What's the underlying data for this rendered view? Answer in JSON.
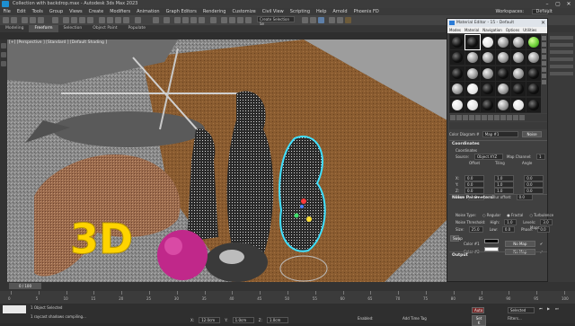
{
  "app": {
    "title": "Collection with backdrop.max - Autodesk 3ds Max 2023",
    "window_buttons": [
      "–",
      "▢",
      "✕"
    ]
  },
  "menu": {
    "items": [
      "File",
      "Edit",
      "Tools",
      "Group",
      "Views",
      "Create",
      "Modifiers",
      "Animation",
      "Graph Editors",
      "Rendering",
      "Customize",
      "Civil View",
      "Scripting",
      "Help",
      "Arnold",
      "Phoenix FD"
    ],
    "workspace_label": "Workspaces:",
    "workspace_value": "Default"
  },
  "toolbar": {
    "selection_set_placeholder": "Create Selection Se"
  },
  "ribbon": {
    "tabs": [
      "Modeling",
      "Freeform",
      "Selection",
      "Object Paint",
      "Populate"
    ],
    "active_tab": "Freeform"
  },
  "viewport": {
    "label": "[+] [Perspective ] [Standard ] [Default Shading ]",
    "overlay_text": "3D"
  },
  "material_editor": {
    "title": "Material Editor - 15 - Default",
    "menu": [
      "Modes",
      "Material",
      "Navigation",
      "Options",
      "Utilities"
    ],
    "slots": [
      "black",
      "black",
      "white",
      "grey",
      "grey",
      "green",
      "black",
      "grey",
      "grey",
      "grey",
      "grey",
      "grey",
      "black",
      "grey",
      "grey",
      "black",
      "grey",
      "black",
      "grey",
      "white",
      "black",
      "grey",
      "black",
      "black",
      "white",
      "white",
      "black",
      "grey",
      "white",
      "black"
    ],
    "name_label": "Color Diagram #",
    "map_type": "Map #1",
    "map_type_button": "Noise",
    "coordinates": {
      "header": "Coordinates",
      "sub": "Coordinates",
      "source_label": "Source:",
      "source_value": "Object XYZ",
      "channel_label": "Map Channel:",
      "channel_value": "1",
      "col_offset": "Offset",
      "col_tiling": "Tiling",
      "col_angle": "Angle",
      "rows": [
        {
          "axis": "X:",
          "offset": "0.0",
          "tiling": "1.0",
          "angle": "0.0"
        },
        {
          "axis": "Y:",
          "offset": "0.0",
          "tiling": "1.0",
          "angle": "0.0"
        },
        {
          "axis": "Z:",
          "offset": "0.0",
          "tiling": "1.0",
          "angle": "0.0"
        }
      ],
      "blur_label": "Blur:",
      "blur_value": "1.0",
      "blur_offset_label": "Blur offset:",
      "blur_offset_value": "0.0"
    },
    "noise": {
      "header": "Noise Parameters",
      "type_label": "Noise Type:",
      "types": [
        "Regular",
        "Fractal",
        "Turbulence"
      ],
      "selected_type": "Fractal",
      "threshold_label": "Noise Threshold:",
      "high_label": "High:",
      "high_value": "1.0",
      "levels_label": "Levels:",
      "levels_value": "3.0",
      "size_label": "Size:",
      "size_value": "25.0",
      "low_label": "Low:",
      "low_value": "0.0",
      "phase_label": "Phase:",
      "phase_value": "0.0",
      "maps_label": "Maps",
      "swap_label": "Swap",
      "color1_label": "Color #1",
      "color1_map": "No Map",
      "color1_hex": "#000000",
      "color2_label": "Color #2",
      "color2_map": "No Map",
      "color2_hex": "#ffffff"
    },
    "output_header": "Output"
  },
  "timeline": {
    "slider": "0 / 100",
    "ticks": [
      "0",
      "5",
      "10",
      "15",
      "20",
      "25",
      "30",
      "35",
      "40",
      "45",
      "50",
      "55",
      "60",
      "65",
      "70",
      "75",
      "80",
      "85",
      "90",
      "95",
      "100"
    ]
  },
  "status": {
    "selected": "1 Object Selected",
    "prompt": "1 raycast shadows compiling...",
    "x_label": "X:",
    "y_label": "Y:",
    "z_label": "Z:",
    "x_value": "12.0cm",
    "y_value": "1.0cm",
    "z_value": "1.0cm",
    "enabled_label": "Enabled:",
    "add_time_tag": "Add Time Tag",
    "autokey": "Auto",
    "selected_btn": "Selected",
    "setkey": "Set K",
    "filters": "Filters..."
  },
  "colors": {
    "viewport_floor": "#7a7a7a",
    "wood": "#8a5c30",
    "accent": "#1d8fd1",
    "selection_cyan": "#3fe0ff",
    "text_3d": "#ffd400",
    "magenta": "#c0288a"
  }
}
